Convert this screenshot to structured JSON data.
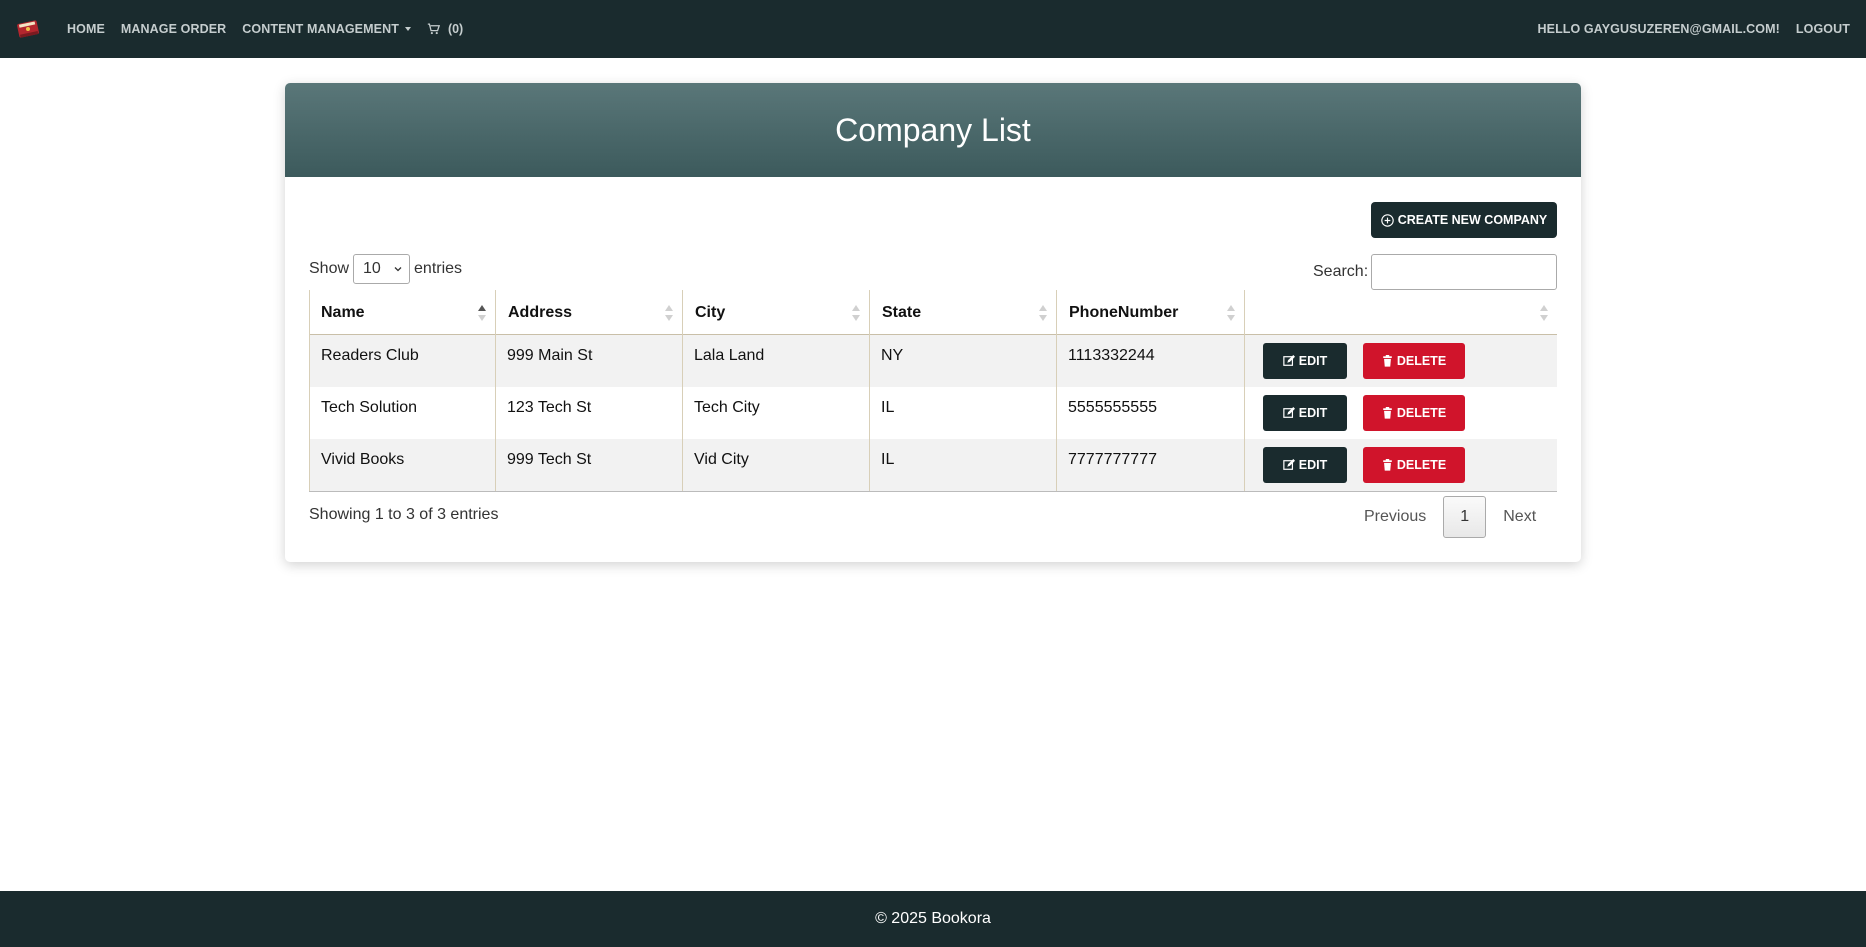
{
  "navbar": {
    "brand_icon": "book-logo-icon",
    "items": [
      "HOME",
      "MANAGE ORDER",
      "CONTENT MANAGEMENT"
    ],
    "cart_count": "(0)",
    "greeting": "HELLO GAYGUSUZEREN@GMAIL.COM!",
    "logout": "LOGOUT"
  },
  "card": {
    "title": "Company List",
    "create_button": "CREATE NEW COMPANY"
  },
  "table_controls": {
    "show_label": "Show",
    "page_size": "10",
    "entries_label": "entries",
    "search_label": "Search:",
    "search_value": ""
  },
  "table": {
    "columns": [
      "Name",
      "Address",
      "City",
      "State",
      "PhoneNumber",
      ""
    ],
    "rows": [
      {
        "name": "Readers Club",
        "address": "999 Main St",
        "city": "Lala Land",
        "state": "NY",
        "phone": "1113332244"
      },
      {
        "name": "Tech Solution",
        "address": "123 Tech St",
        "city": "Tech City",
        "state": "IL",
        "phone": "5555555555"
      },
      {
        "name": "Vivid Books",
        "address": "999 Tech St",
        "city": "Vid City",
        "state": "IL",
        "phone": "7777777777"
      }
    ],
    "edit_label": "EDIT",
    "delete_label": "DELETE"
  },
  "pagination": {
    "info": "Showing 1 to 3 of 3 entries",
    "previous": "Previous",
    "current": "1",
    "next": "Next"
  },
  "footer": {
    "text": "© 2025 Bookora"
  },
  "colors": {
    "navbar_bg": "#1a2b2e",
    "header_gradient_top": "#5a7779",
    "header_gradient_bottom": "#3c5a5c",
    "danger": "#d0142b"
  }
}
